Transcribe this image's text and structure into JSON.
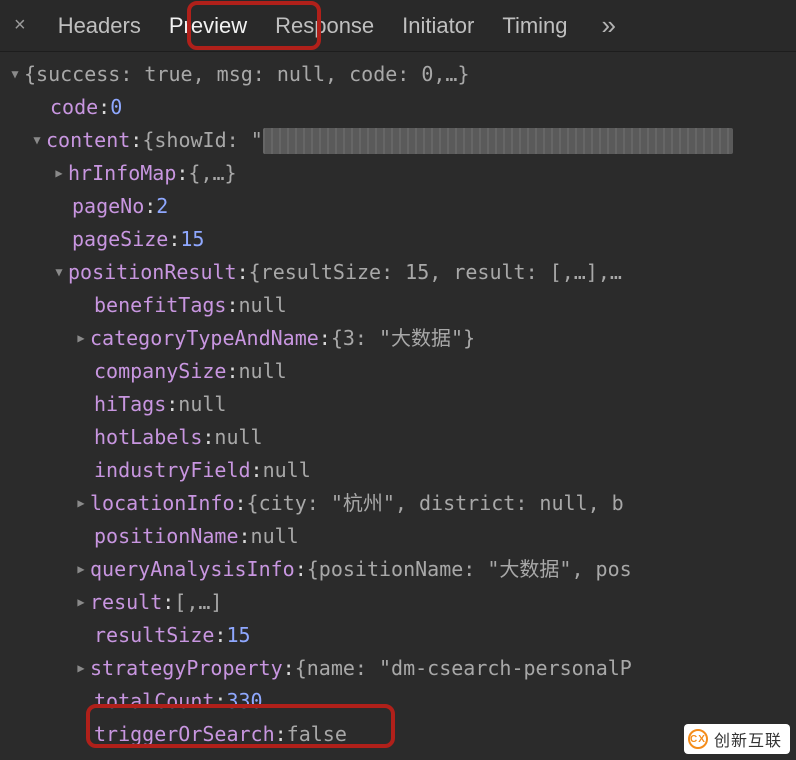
{
  "tabs": {
    "close": "×",
    "items": [
      "Headers",
      "Preview",
      "Response",
      "Initiator",
      "Timing"
    ],
    "overflow": "»",
    "active_index": 1
  },
  "tree": {
    "root_preview": "{success: true, msg: null, code: 0,…}",
    "code": {
      "key": "code",
      "value": 0
    },
    "content": {
      "key": "content",
      "preview_prefix": "{showId: \"",
      "hrInfoMap": {
        "key": "hrInfoMap",
        "preview": "{,…}"
      },
      "pageNo": {
        "key": "pageNo",
        "value": 2
      },
      "pageSize": {
        "key": "pageSize",
        "value": 15
      },
      "positionResult": {
        "key": "positionResult",
        "preview": "{resultSize: 15, result: [,…],…",
        "benefitTags": {
          "key": "benefitTags",
          "value": "null"
        },
        "categoryTypeAndName": {
          "key": "categoryTypeAndName",
          "preview": "{3: \"大数据\"}"
        },
        "companySize": {
          "key": "companySize",
          "value": "null"
        },
        "hiTags": {
          "key": "hiTags",
          "value": "null"
        },
        "hotLabels": {
          "key": "hotLabels",
          "value": "null"
        },
        "industryField": {
          "key": "industryField",
          "value": "null"
        },
        "locationInfo": {
          "key": "locationInfo",
          "preview": "{city: \"杭州\", district: null, b"
        },
        "positionName": {
          "key": "positionName",
          "value": "null"
        },
        "queryAnalysisInfo": {
          "key": "queryAnalysisInfo",
          "preview": "{positionName: \"大数据\", pos"
        },
        "result": {
          "key": "result",
          "preview": "[,…]"
        },
        "resultSize": {
          "key": "resultSize",
          "value": 15
        },
        "strategyProperty": {
          "key": "strategyProperty",
          "preview": "{name: \"dm-csearch-personalP"
        },
        "totalCount": {
          "key": "totalCount",
          "value": 330
        },
        "triggerOrSearch": {
          "key": "triggerOrSearch",
          "value": "false"
        }
      }
    }
  },
  "watermark": "创新互联",
  "glyphs": {
    "expanded": "▼",
    "collapsed": "▶"
  }
}
